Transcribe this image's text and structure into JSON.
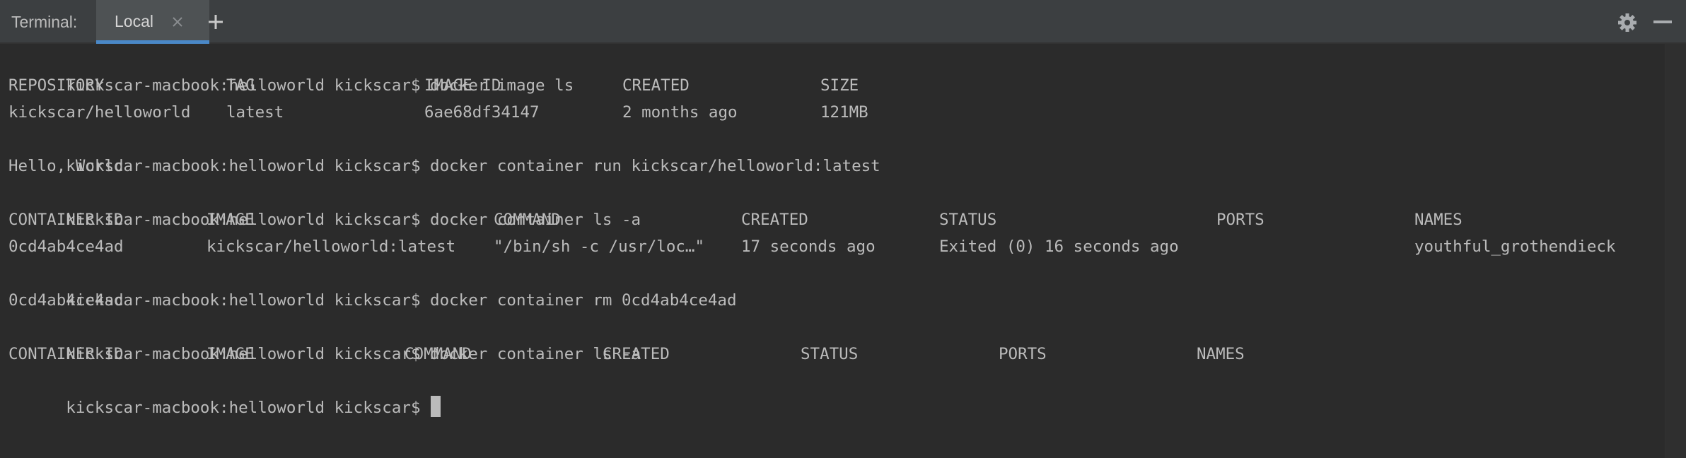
{
  "tabbar": {
    "label": "Terminal:",
    "tabs": [
      {
        "label": "Local",
        "active": true
      }
    ],
    "accent_color": "#4a88c7"
  },
  "terminal": {
    "prompt": "kickscar-macbook:helloworld kickscar$",
    "commands": [
      "docker image ls",
      "docker container run kickscar/helloworld:latest",
      "docker container ls -a",
      "docker container rm 0cd4ab4ce4ad",
      "docker container ls -a"
    ],
    "image_ls": {
      "headers": [
        "REPOSITORY",
        "TAG",
        "IMAGE ID",
        "CREATED",
        "SIZE"
      ],
      "rows": [
        [
          "kickscar/helloworld",
          "latest",
          "6ae68df34147",
          "2 months ago",
          "121MB"
        ]
      ]
    },
    "run_output": "Hello, World",
    "container_ls_1": {
      "headers": [
        "CONTAINER ID",
        "IMAGE",
        "COMMAND",
        "CREATED",
        "STATUS",
        "PORTS",
        "NAMES"
      ],
      "rows": [
        [
          "0cd4ab4ce4ad",
          "kickscar/helloworld:latest",
          "\"/bin/sh -c /usr/loc…\"",
          "17 seconds ago",
          "Exited (0) 16 seconds ago",
          "",
          "youthful_grothendieck"
        ]
      ]
    },
    "rm_output": "0cd4ab4ce4ad",
    "container_ls_2": {
      "headers": [
        "CONTAINER ID",
        "IMAGE",
        "COMMAND",
        "CREATED",
        "STATUS",
        "PORTS",
        "NAMES"
      ]
    }
  }
}
